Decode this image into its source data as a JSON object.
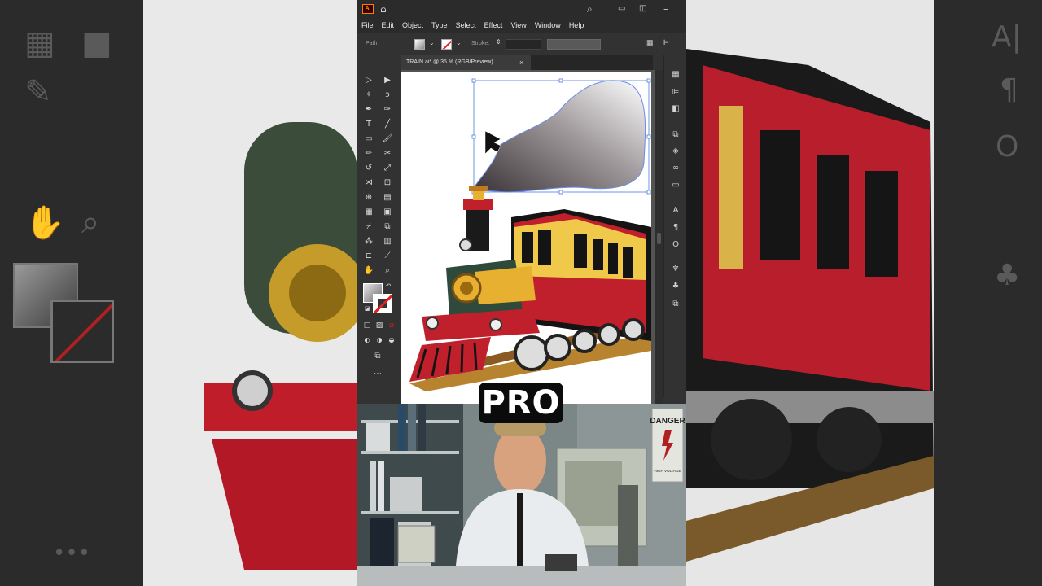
{
  "menubar": {
    "items": [
      "File",
      "Edit",
      "Object",
      "Type",
      "Select",
      "Effect",
      "View",
      "Window",
      "Help"
    ]
  },
  "controlbar": {
    "selection_label": "Path",
    "stroke_label": "Stroke:"
  },
  "document_tab": {
    "title": "TRAIN.ai* @ 35 % (RGB/Preview)",
    "close_glyph": "×"
  },
  "caption": {
    "text": "PRO"
  },
  "poster": {
    "headline": "DANGER",
    "subtext": "HIGH VOLTAGE"
  },
  "colors": {
    "fill_gradient_start": "#ffffff",
    "fill_gradient_end": "#3a3438",
    "stroke": "none",
    "selection": "#4a7be0"
  }
}
